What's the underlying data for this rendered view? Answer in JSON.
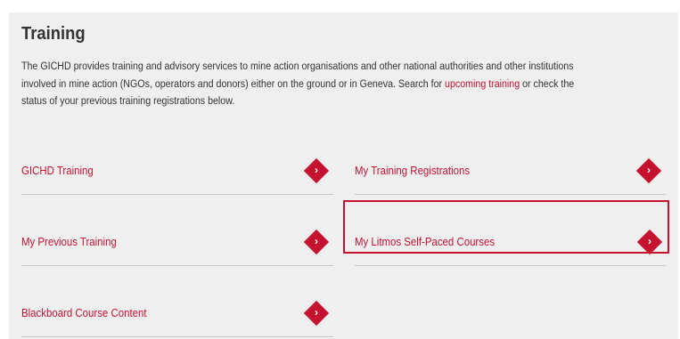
{
  "page": {
    "title": "Training",
    "intro_before_link": "The GICHD provides training and advisory services to mine action organisations and other national authorities and other institutions involved in mine action (NGOs, operators and donors) either on the ground or in Geneva. Search for ",
    "intro_link": "upcoming training",
    "intro_after_link": " or check the status of your previous training registrations below."
  },
  "cards": [
    {
      "label": "GICHD Training",
      "arrow": "›"
    },
    {
      "label": "My Training Registrations",
      "arrow": "›"
    },
    {
      "label": "My Previous Training",
      "arrow": "›"
    },
    {
      "label": "My Litmos Self-Paced Courses",
      "arrow": "›"
    },
    {
      "label": "Blackboard Course Content",
      "arrow": "›"
    }
  ],
  "colors": {
    "accent": "#c4122f",
    "panel_background": "#efefef",
    "text": "#333333",
    "divider": "#c7c7c7"
  },
  "icons": {
    "card_arrow": "chevron-right-icon"
  }
}
